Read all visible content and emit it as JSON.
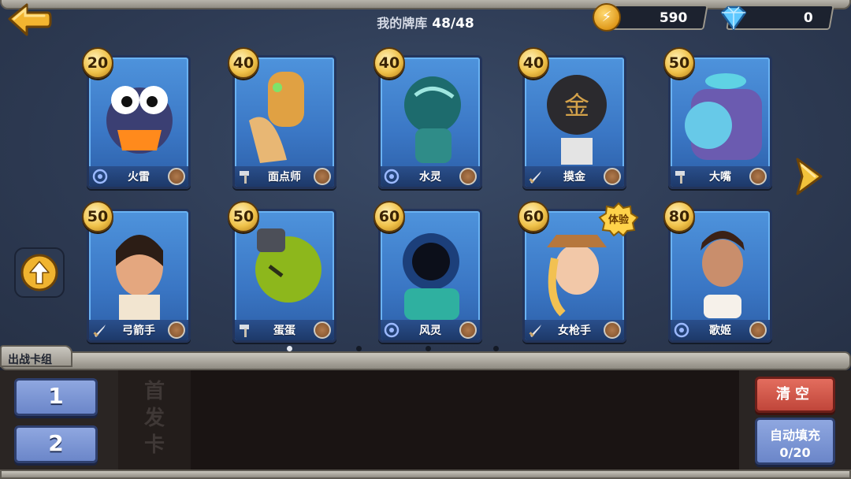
{
  "header": {
    "title": "我的牌库",
    "count": "48/48",
    "gold": "590",
    "gems": "0",
    "gold_icon_glyph": "⚡"
  },
  "colors": {
    "card_blue": "#4e93dc",
    "cost_gold": "#f0c24a",
    "clear_red": "#c0463a",
    "button_blue": "#6b86c9"
  },
  "cards": [
    {
      "name": "火雷",
      "cost": "20",
      "type_icon": "spiral-icon"
    },
    {
      "name": "面点师",
      "cost": "40",
      "type_icon": "hammer-icon"
    },
    {
      "name": "水灵",
      "cost": "40",
      "type_icon": "spiral-icon"
    },
    {
      "name": "摸金",
      "cost": "40",
      "type_icon": "sword-icon"
    },
    {
      "name": "大嘴",
      "cost": "50",
      "type_icon": "hammer-icon"
    },
    {
      "name": "弓箭手",
      "cost": "50",
      "type_icon": "sword-icon"
    },
    {
      "name": "蛋蛋",
      "cost": "50",
      "type_icon": "hammer-icon"
    },
    {
      "name": "风灵",
      "cost": "60",
      "type_icon": "spiral-icon"
    },
    {
      "name": "女枪手",
      "cost": "60",
      "type_icon": "sword-icon",
      "badge": "体验"
    },
    {
      "name": "歌姬",
      "cost": "80",
      "type_icon": "spiral-icon"
    }
  ],
  "pagination": {
    "pages": 4,
    "current": 1
  },
  "deck": {
    "tab_label": "出战卡组",
    "slot_1": "1",
    "slot_2": "2",
    "placeholder": "首发卡",
    "clear_label": "清空",
    "autofill_label": "自动填充",
    "autofill_count": "0/20"
  }
}
